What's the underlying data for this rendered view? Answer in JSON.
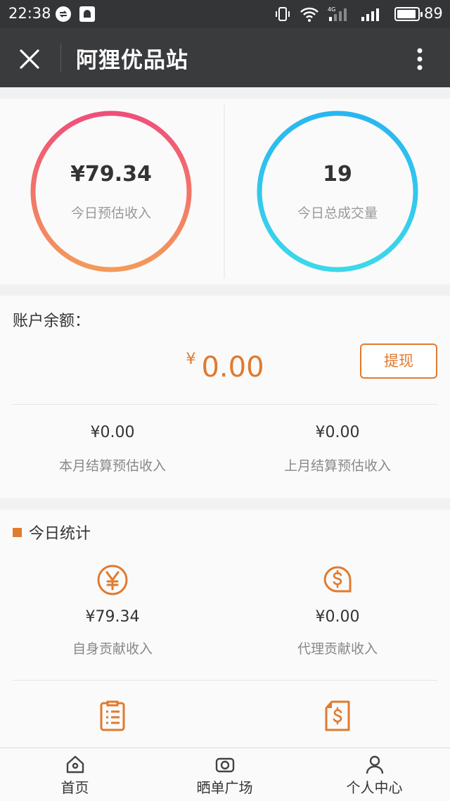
{
  "status_bar": {
    "time": "22:38",
    "battery_percent": "89",
    "battery_level": 0.89
  },
  "title_bar": {
    "title": "阿狸优品站",
    "close_icon": "close-icon",
    "more_icon": "more-vertical-icon"
  },
  "overview": {
    "income": {
      "value": "¥79.34",
      "label": "今日预估收入",
      "ring_colors": [
        "#ef4f7a",
        "#f39a5a"
      ]
    },
    "volume": {
      "value": "19",
      "label": "今日总成交量",
      "ring_colors": [
        "#29b6f0",
        "#3cd8ea"
      ]
    }
  },
  "balance": {
    "title": "账户余额：",
    "currency": "¥",
    "amount": "0.00",
    "withdraw_label": "提现",
    "this_month": {
      "value": "¥0.00",
      "label": "本月结算预估收入"
    },
    "last_month": {
      "value": "¥0.00",
      "label": "上月结算预估收入"
    }
  },
  "today_stats": {
    "title": "今日统计",
    "items": [
      {
        "icon": "yuan-circle-icon",
        "value": "¥79.34",
        "label": "自身贡献收入"
      },
      {
        "icon": "dollar-tag-icon",
        "value": "¥0.00",
        "label": "代理贡献收入"
      },
      {
        "icon": "list-document-icon"
      },
      {
        "icon": "dollar-document-icon"
      }
    ]
  },
  "bottom_nav": [
    {
      "label": "首页",
      "icon": "home-icon"
    },
    {
      "label": "晒单广场",
      "icon": "camera-icon"
    },
    {
      "label": "个人中心",
      "icon": "person-icon"
    }
  ],
  "colors": {
    "accent": "#e07a2e",
    "title_bar_bg": "#3a3b3d",
    "status_bar_bg": "#333537"
  }
}
